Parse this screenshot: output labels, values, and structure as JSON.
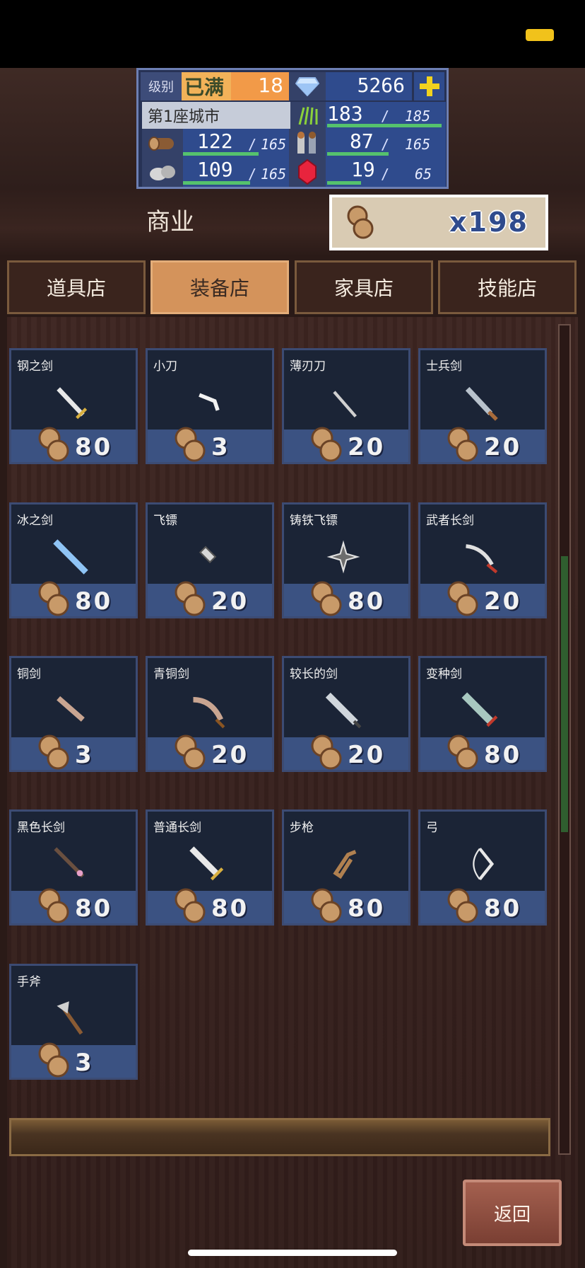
{
  "stats": {
    "level_label": "级别",
    "level_full": "已满",
    "level": "18",
    "gems": "5266",
    "city": "第1座城市",
    "food": {
      "value": "183",
      "max": "185",
      "fill": 0.99
    },
    "wood": {
      "value": "122",
      "max": "165",
      "fill": 0.74
    },
    "people": {
      "value": "87",
      "max": "165",
      "fill": 0.53
    },
    "stone": {
      "value": "109",
      "max": "165",
      "fill": 0.66
    },
    "ruby": {
      "value": "19",
      "max": "65",
      "fill": 0.29
    },
    "slash": "/"
  },
  "header": {
    "title": "商业",
    "resource_amount": "x198"
  },
  "tabs": [
    {
      "label": "道具店",
      "active": false
    },
    {
      "label": "装备店",
      "active": true
    },
    {
      "label": "家具店",
      "active": false
    },
    {
      "label": "技能店",
      "active": false
    }
  ],
  "items": [
    {
      "name": "钢之剑",
      "price": "80",
      "icon": "steel-sword-icon"
    },
    {
      "name": "小刀",
      "price": "3",
      "icon": "knife-icon"
    },
    {
      "name": "薄刃刀",
      "price": "20",
      "icon": "thin-blade-icon"
    },
    {
      "name": "士兵剑",
      "price": "20",
      "icon": "soldier-sword-icon"
    },
    {
      "name": "冰之剑",
      "price": "80",
      "icon": "ice-sword-icon"
    },
    {
      "name": "飞镖",
      "price": "20",
      "icon": "dart-icon"
    },
    {
      "name": "铸铁飞镖",
      "price": "80",
      "icon": "shuriken-icon"
    },
    {
      "name": "武者长剑",
      "price": "20",
      "icon": "warrior-longsword-icon"
    },
    {
      "name": "铜剑",
      "price": "3",
      "icon": "copper-sword-icon"
    },
    {
      "name": "青铜剑",
      "price": "20",
      "icon": "bronze-sword-icon"
    },
    {
      "name": "较长的剑",
      "price": "20",
      "icon": "long-sword-icon"
    },
    {
      "name": "变种剑",
      "price": "80",
      "icon": "mutant-sword-icon"
    },
    {
      "name": "黑色长剑",
      "price": "80",
      "icon": "black-longsword-icon"
    },
    {
      "name": "普通长剑",
      "price": "80",
      "icon": "normal-longsword-icon"
    },
    {
      "name": "步枪",
      "price": "80",
      "icon": "rifle-icon"
    },
    {
      "name": "弓",
      "price": "80",
      "icon": "bow-icon"
    },
    {
      "name": "手斧",
      "price": "3",
      "icon": "hand-axe-icon"
    }
  ],
  "back_label": "返回"
}
